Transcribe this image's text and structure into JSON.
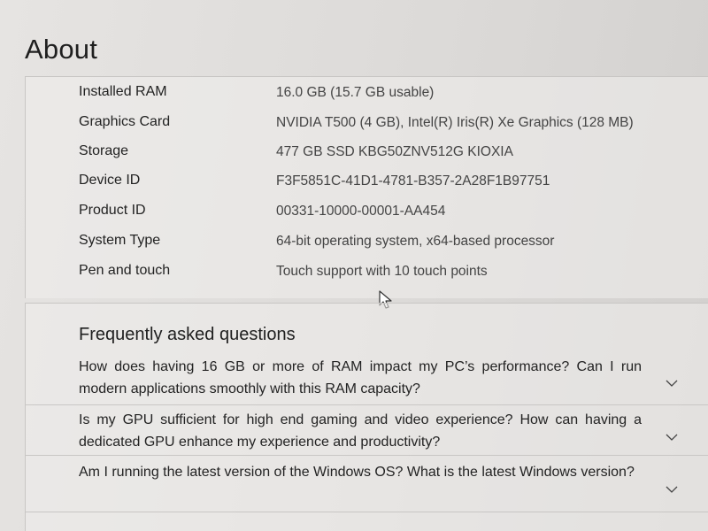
{
  "header": {
    "title": "About"
  },
  "specs": [
    {
      "label": "Installed RAM",
      "value": "16.0 GB (15.7 GB usable)"
    },
    {
      "label": "Graphics Card",
      "value": "NVIDIA T500 (4 GB), Intel(R) Iris(R) Xe Graphics (128 MB)"
    },
    {
      "label": "Storage",
      "value": "477 GB SSD KBG50ZNV512G KIOXIA"
    },
    {
      "label": "Device ID",
      "value": "F3F5851C-41D1-4781-B357-2A28F1B97751"
    },
    {
      "label": "Product ID",
      "value": "00331-10000-00001-AA454"
    },
    {
      "label": "System Type",
      "value": "64-bit operating system, x64-based processor"
    },
    {
      "label": "Pen and touch",
      "value": "Touch support with 10 touch points"
    }
  ],
  "faq": {
    "title": "Frequently asked questions",
    "items": [
      {
        "question": "How does having 16 GB or more of RAM impact my PC’s performance? Can I run modern applications smoothly with this RAM capacity?"
      },
      {
        "question": "Is my GPU sufficient for high end gaming and video experience? How can having a dedicated GPU enhance my experience and productivity?"
      },
      {
        "question": "Am I running the latest version of the Windows OS? What is the latest Windows version?"
      }
    ]
  },
  "icons": {
    "chevron": "chevron-down-icon",
    "cursor": "mouse-pointer-icon"
  },
  "colors": {
    "background": "#dcdad8",
    "panel": "#eeecea",
    "text": "#2b2b2b",
    "divider": "#c9c7c5"
  }
}
